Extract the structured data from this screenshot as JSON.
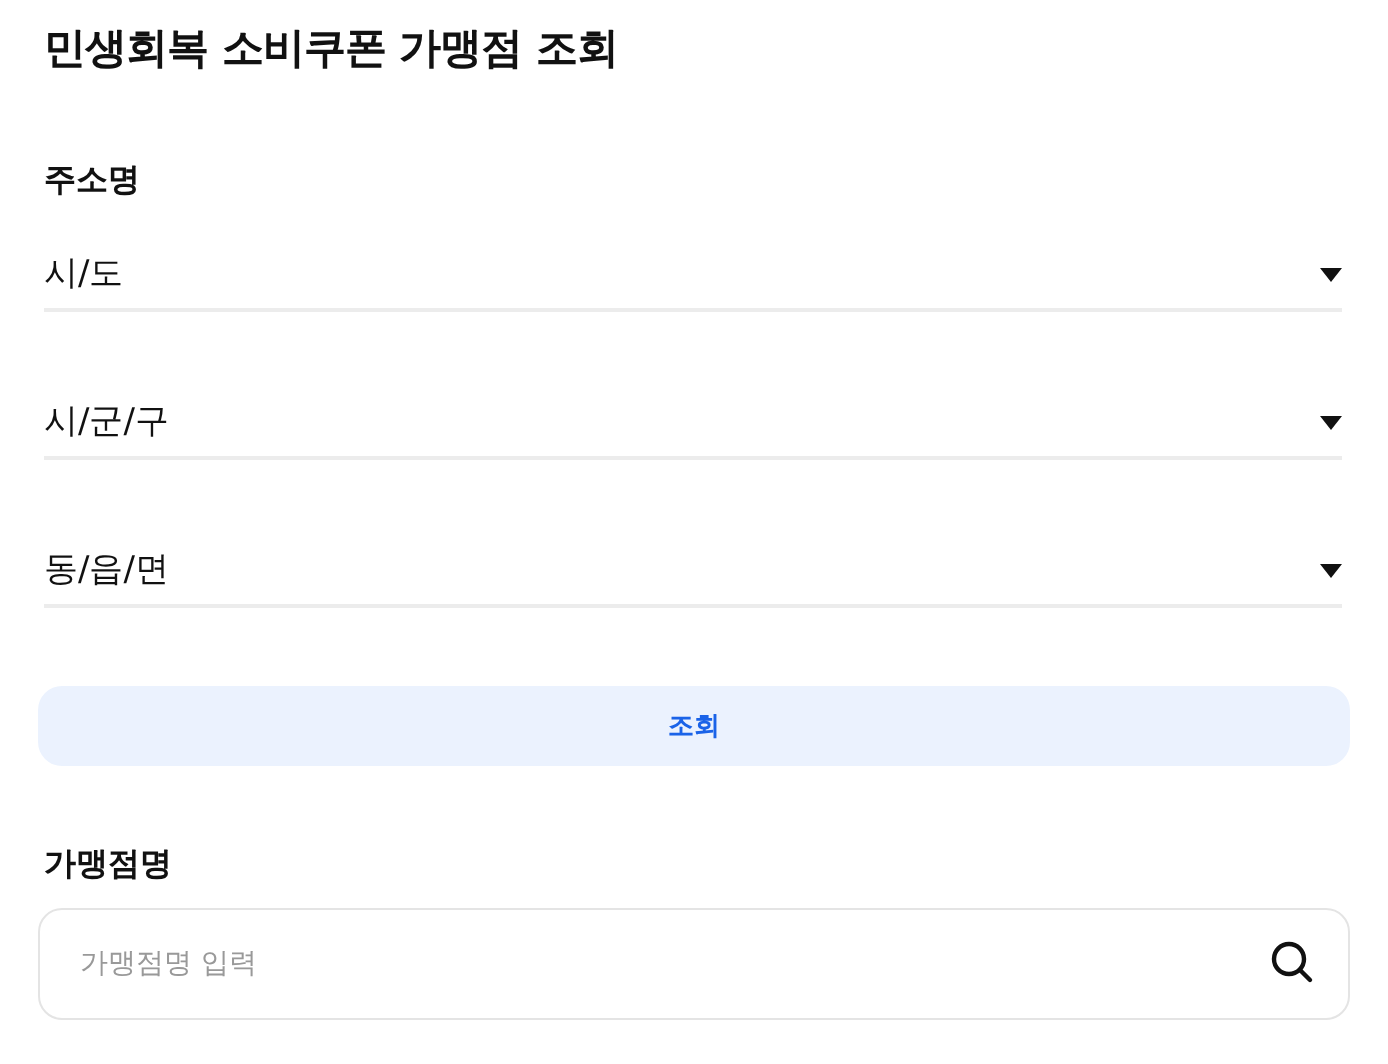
{
  "title": "민생회복 소비쿠폰 가맹점 조회",
  "address_section": {
    "label": "주소명",
    "selects": [
      {
        "value": "시/도"
      },
      {
        "value": "시/군/구"
      },
      {
        "value": "동/읍/면"
      }
    ]
  },
  "search_button": {
    "label": "조회"
  },
  "store_section": {
    "label": "가맹점명",
    "placeholder": "가맹점명 입력"
  }
}
